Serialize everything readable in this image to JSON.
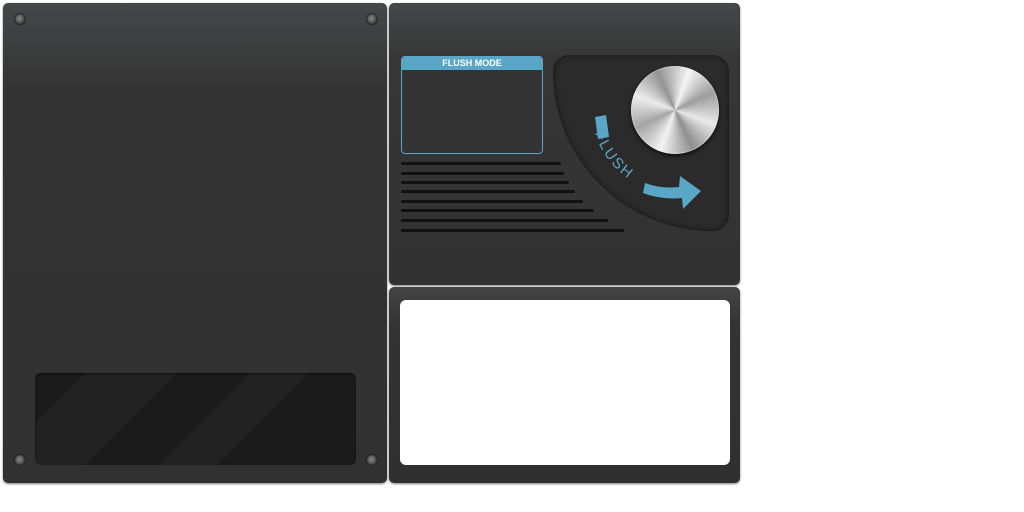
{
  "flush_mode": {
    "title": "FLUSH MODE"
  },
  "dial": {
    "label": "FLUSH",
    "accent_color": "#5aa6c6"
  },
  "icons": {
    "arrow": "curved-arrow-icon",
    "screw": "screw-icon"
  }
}
